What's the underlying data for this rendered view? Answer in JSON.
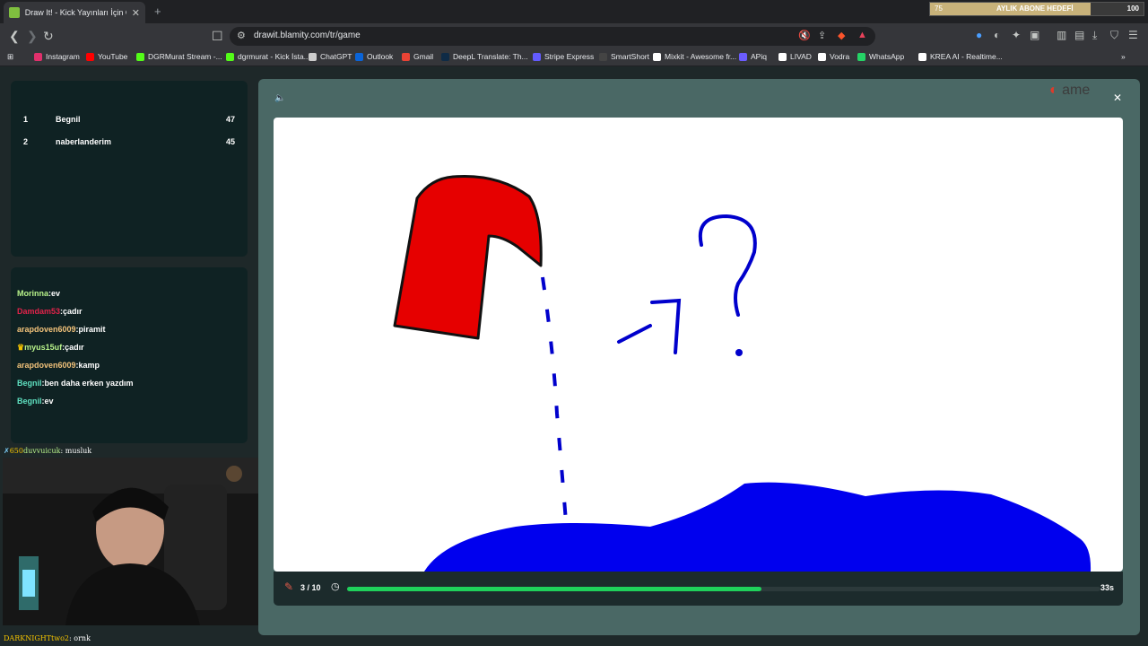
{
  "browser": {
    "tab_title": "Draw It! - Kick Yayınları İçin Ç",
    "url": "drawit.blamity.com/tr/game",
    "bookmarks": [
      "Instagram",
      "YouTube",
      "DGRMurat Stream -...",
      "dgrmurat - Kick İsta...",
      "ChatGPT",
      "Outlook",
      "Gmail",
      "DeepL Translate: Th...",
      "Stripe Express",
      "SmartShort",
      "Mixkit - Awesome fr...",
      "APiq",
      "LIVAD",
      "Vodra",
      "WhatsApp",
      "KREA AI - Realtime..."
    ]
  },
  "sub_goal": {
    "start": "75",
    "label": "AYLIK ABONE HEDEFİ",
    "end": "100",
    "progress": 0.75
  },
  "leaderboard": [
    {
      "rank": "1",
      "name": "Begnil",
      "score": "47"
    },
    {
      "rank": "2",
      "name": "naberlanderim",
      "score": "45"
    }
  ],
  "chat": [
    {
      "user": "Morinna",
      "text": ":ev",
      "color": "#b8f28a"
    },
    {
      "user": "Damdam53",
      "text": ":çadır",
      "color": "#e0234a"
    },
    {
      "user": "arapdoven6009",
      "text": ":piramit",
      "color": "#f2c27a"
    },
    {
      "user": "myus15uf",
      "text": ":çadır",
      "color": "#b8f28a",
      "crown": true
    },
    {
      "user": "arapdoven6009",
      "text": ":kamp",
      "color": "#f2c27a"
    },
    {
      "user": "Begnil",
      "text": ":ben daha erken yazdım",
      "color": "#5fe0c0"
    },
    {
      "user": "Begnil",
      "text": ":ev",
      "color": "#5fe0c0"
    }
  ],
  "stream_chat": {
    "above": {
      "user": "duvvuicuk",
      "text": ": musluk"
    },
    "below": {
      "user": "DARKNIGHTtwo2",
      "text": ": ornk"
    }
  },
  "game": {
    "round": "3 / 10",
    "time_left": "33s",
    "timer_progress": 0.55,
    "brand": "ame"
  },
  "colors": {
    "accent": "#1fd15b",
    "modal_bg": "#4a6865",
    "panel_bg": "#0f2223"
  }
}
